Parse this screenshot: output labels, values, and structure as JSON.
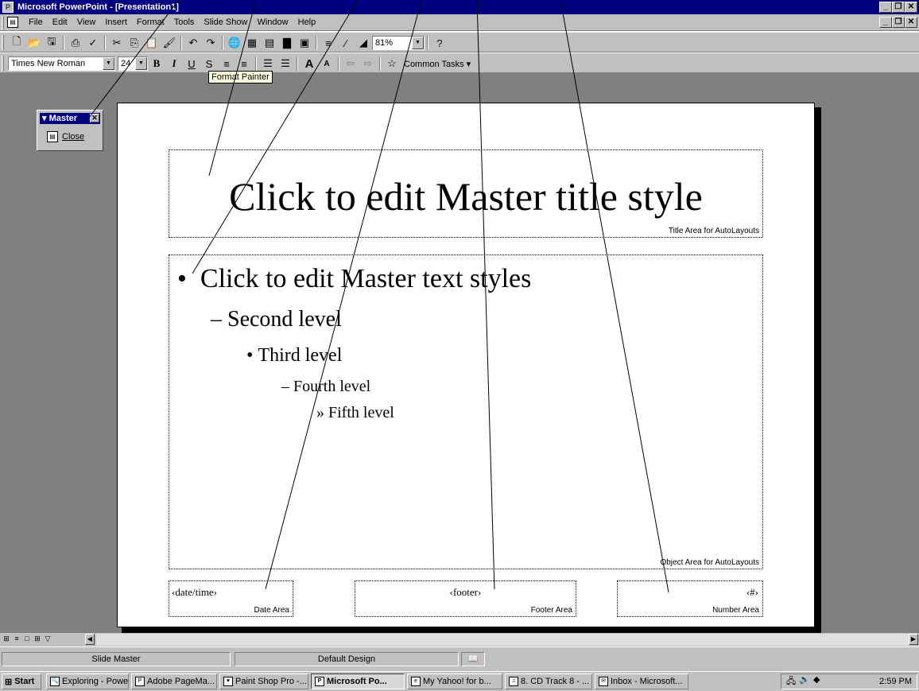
{
  "window": {
    "title": "Microsoft PowerPoint - [Presentation1]"
  },
  "menubar": {
    "items": [
      "File",
      "Edit",
      "View",
      "Insert",
      "Format",
      "Tools",
      "Slide Show",
      "Window",
      "Help"
    ]
  },
  "standard_toolbar": {
    "zoom": "81%"
  },
  "formatting_toolbar": {
    "font": "Times New Roman",
    "size": "24",
    "common_tasks": "Common Tasks ▾",
    "tooltip": "Format Painter"
  },
  "master_toolbar": {
    "title": "▾ Master",
    "close_label": "Close"
  },
  "slide": {
    "title_text": "Click to edit Master title style",
    "title_area_label": "Title Area for AutoLayouts",
    "body_levels": [
      {
        "bullet": "•",
        "text": "Click to edit Master text styles"
      },
      {
        "bullet": "–",
        "text": "Second level"
      },
      {
        "bullet": "•",
        "text": "Third level"
      },
      {
        "bullet": "–",
        "text": "Fourth level"
      },
      {
        "bullet": "»",
        "text": "Fifth level"
      }
    ],
    "object_area_label": "Object Area for AutoLayouts",
    "date_field": "‹date/time›",
    "date_area_label": "Date Area",
    "footer_field": "‹footer›",
    "footer_area_label": "Footer Area",
    "number_field": "‹#›",
    "number_area_label": "Number Area"
  },
  "statusbar": {
    "view": "Slide Master",
    "design": "Default Design"
  },
  "taskbar": {
    "start": "Start",
    "tasks": [
      "Exploring - Powe...",
      "Adobe PageMa...",
      "Paint Shop Pro -...",
      "Microsoft Po...",
      "My Yahoo! for b...",
      "8. CD Track 8 - ...",
      "Inbox - Microsoft..."
    ],
    "clock": "2:59 PM"
  },
  "colors": {
    "titlebar": "#000080",
    "chrome": "#c0c0c0",
    "workspace": "#808080"
  }
}
